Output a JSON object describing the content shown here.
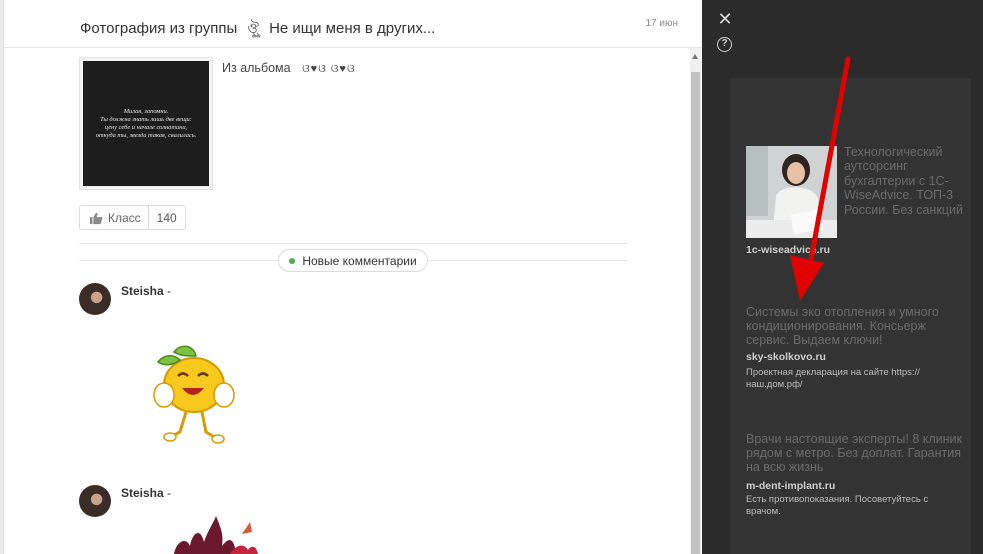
{
  "post": {
    "title_prefix": "Фотография из группы",
    "group_ornament": "ঔৣ",
    "group_name": "Не ищи меня в других...",
    "date": "17 июн",
    "photo_text": "Милая, запомни.\nТы должна знать лишь две вещи:\nцену себе и начале солнатини,\nоткуда ты, звезда такая, свалилась.",
    "album_label": "Из альбома",
    "album_ornament": "ଓ♥ଓ    ଓ♥ଓ",
    "class_label": "Класс",
    "class_count": "140",
    "new_comments_label": "Новые комментарии"
  },
  "comments": [
    {
      "author": "Steisha",
      "suffix": "-"
    },
    {
      "author": "Steisha",
      "suffix": "-"
    }
  ],
  "ads": [
    {
      "title": "Технологический аутсорсинг бухгалтерии с 1С-WiseAdvice. ТОП-3 России. Без санкций",
      "domain": "1c-wiseadvice.ru"
    },
    {
      "title": "Системы эко отопления и умного кондиционирования. Консьерж сервис. Выдаем ключи!",
      "domain": "sky-skolkovo.ru",
      "description": "Проектная декларация на сайте https://наш.дом.рф/"
    },
    {
      "title": "Врачи настоящие эксперты! 8 клиник рядом с метро. Без доплат. Гарантия на всю жизнь",
      "domain": "m-dent-implant.ru",
      "description": "Есть противопоказания. Посоветуйтесь с врачом."
    }
  ],
  "icons": {
    "close": "close-icon",
    "help": "help-icon",
    "like": "thumbs-up-icon",
    "annotation": "red-arrow"
  },
  "colors": {
    "overlay": "#2b2b2b",
    "new_dot": "#4caf50",
    "arrow": "#e00000"
  }
}
